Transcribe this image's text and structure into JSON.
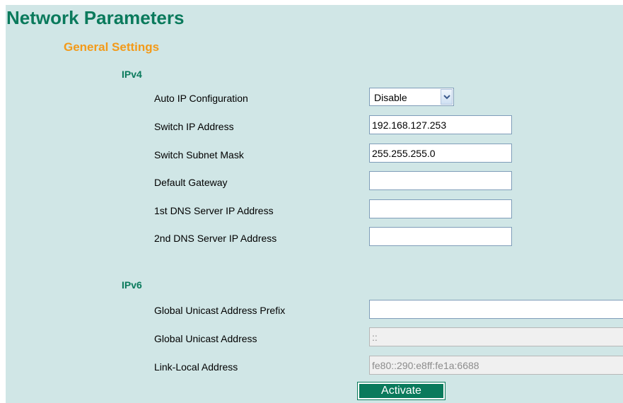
{
  "page": {
    "title": "Network Parameters"
  },
  "general_settings": {
    "title": "General Settings"
  },
  "ipv4": {
    "title": "IPv4",
    "auto_ip": {
      "label": "Auto IP Configuration",
      "selected": "Disable"
    },
    "switch_ip": {
      "label": "Switch IP Address",
      "value": "192.168.127.253"
    },
    "subnet_mask": {
      "label": "Switch Subnet Mask",
      "value": "255.255.255.0"
    },
    "default_gateway": {
      "label": "Default Gateway",
      "value": ""
    },
    "dns1": {
      "label": "1st DNS Server IP Address",
      "value": ""
    },
    "dns2": {
      "label": "2nd DNS Server IP Address",
      "value": ""
    }
  },
  "ipv6": {
    "title": "IPv6",
    "global_prefix": {
      "label": "Global Unicast Address Prefix",
      "value": ""
    },
    "global_address": {
      "label": "Global Unicast Address",
      "value": "::"
    },
    "link_local": {
      "label": "Link-Local Address",
      "value": "fe80::290:e8ff:fe1a:6688"
    }
  },
  "actions": {
    "activate_label": "Activate"
  },
  "colors": {
    "panel_background": "#d0e6e6",
    "title_green": "#0a7a5c",
    "section_orange": "#f39a19"
  }
}
